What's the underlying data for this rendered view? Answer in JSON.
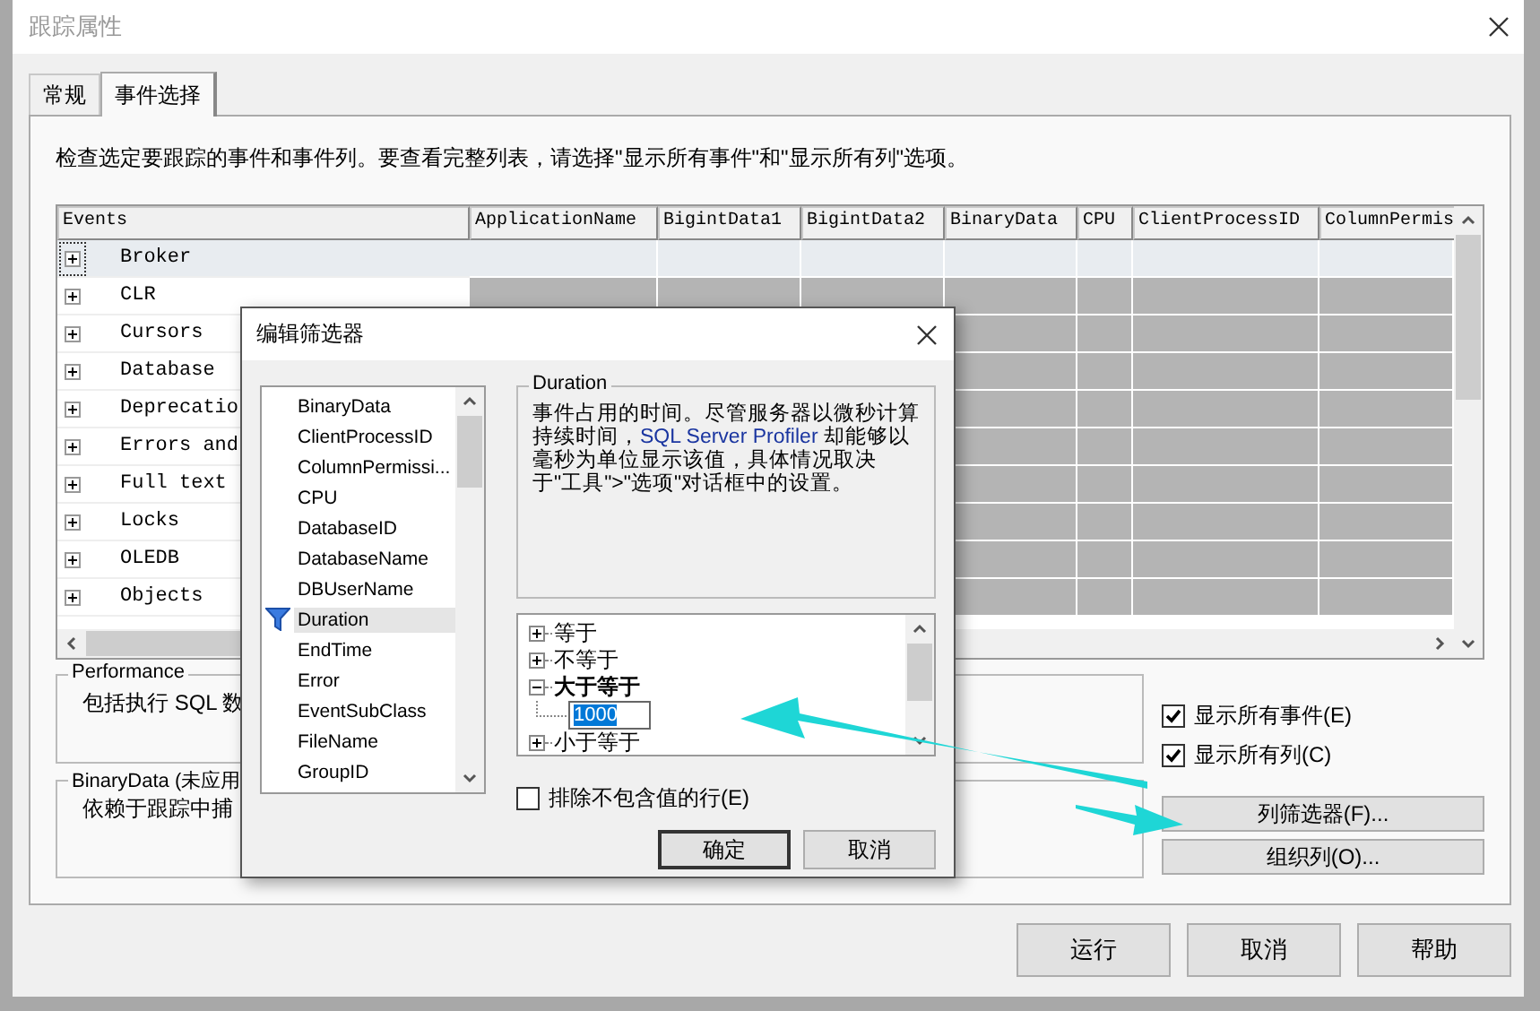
{
  "window": {
    "title": "跟踪属性"
  },
  "tabs": [
    {
      "label": "常规",
      "selected": false
    },
    {
      "label": "事件选择",
      "selected": true
    }
  ],
  "instruction": "检查选定要跟踪的事件和事件列。要查看完整列表，请选择\"显示所有事件\"和\"显示所有列\"选项。",
  "events_grid": {
    "columns": [
      "Events",
      "ApplicationName",
      "BigintData1",
      "BigintData2",
      "BinaryData",
      "CPU",
      "ClientProcessID",
      "ColumnPermis"
    ],
    "rows": [
      {
        "name": "Broker",
        "selected": true,
        "expanded": false
      },
      {
        "name": "CLR",
        "selected": false,
        "expanded": false
      },
      {
        "name": "Cursors",
        "selected": false,
        "expanded": false
      },
      {
        "name": "Database",
        "selected": false,
        "expanded": false
      },
      {
        "name": "Deprecatio",
        "selected": false,
        "expanded": false
      },
      {
        "name": "Errors and",
        "selected": false,
        "expanded": false
      },
      {
        "name": "Full text",
        "selected": false,
        "expanded": false
      },
      {
        "name": "Locks",
        "selected": false,
        "expanded": false
      },
      {
        "name": "OLEDB",
        "selected": false,
        "expanded": false
      },
      {
        "name": "Objects",
        "selected": false,
        "expanded": false
      }
    ]
  },
  "groups": [
    {
      "title": "Performance",
      "text": "包括执行 SQL 数"
    },
    {
      "title": "BinaryData (未应用",
      "text": "依赖于跟踪中捕"
    }
  ],
  "options": [
    {
      "label": "显示所有事件(E)",
      "checked": true
    },
    {
      "label": "显示所有列(C)",
      "checked": true
    }
  ],
  "side_buttons": [
    "列筛选器(F)...",
    "组织列(O)..."
  ],
  "footer_buttons": [
    "运行",
    "取消",
    "帮助"
  ],
  "filter_dialog": {
    "title": "编辑筛选器",
    "columns": [
      {
        "label": "BinaryData",
        "selected": false,
        "filtered": false
      },
      {
        "label": "ClientProcessID",
        "selected": false,
        "filtered": false
      },
      {
        "label": "ColumnPermissi...",
        "selected": false,
        "filtered": false
      },
      {
        "label": "CPU",
        "selected": false,
        "filtered": false
      },
      {
        "label": "DatabaseID",
        "selected": false,
        "filtered": false
      },
      {
        "label": "DatabaseName",
        "selected": false,
        "filtered": false
      },
      {
        "label": "DBUserName",
        "selected": false,
        "filtered": false
      },
      {
        "label": "Duration",
        "selected": true,
        "filtered": true
      },
      {
        "label": "EndTime",
        "selected": false,
        "filtered": false
      },
      {
        "label": "Error",
        "selected": false,
        "filtered": false
      },
      {
        "label": "EventSubClass",
        "selected": false,
        "filtered": false
      },
      {
        "label": "FileName",
        "selected": false,
        "filtered": false
      },
      {
        "label": "GroupID",
        "selected": false,
        "filtered": false
      }
    ],
    "description": {
      "title": "Duration",
      "parts": [
        {
          "kind": "plain",
          "text": "事件占用的时间。尽管服务器以微秒计算持续时间，"
        },
        {
          "kind": "highlight",
          "text": "SQL Server Profiler"
        },
        {
          "kind": "plain",
          "text": " 却能够以毫秒为单位显示该值，具体情况取决于\"工具\">\"选项\"对话框中的设置。"
        }
      ]
    },
    "operators": [
      {
        "label": "等于",
        "expanded": false,
        "selected": false
      },
      {
        "label": "不等于",
        "expanded": false,
        "selected": false
      },
      {
        "label": "大于等于",
        "expanded": true,
        "selected": true,
        "children": [
          {
            "value": "1000"
          }
        ]
      },
      {
        "label": "小于等于",
        "expanded": false,
        "selected": false
      }
    ],
    "exclude": {
      "label": "排除不包含值的行(E)",
      "checked": false
    },
    "buttons": [
      "确定",
      "取消"
    ]
  }
}
